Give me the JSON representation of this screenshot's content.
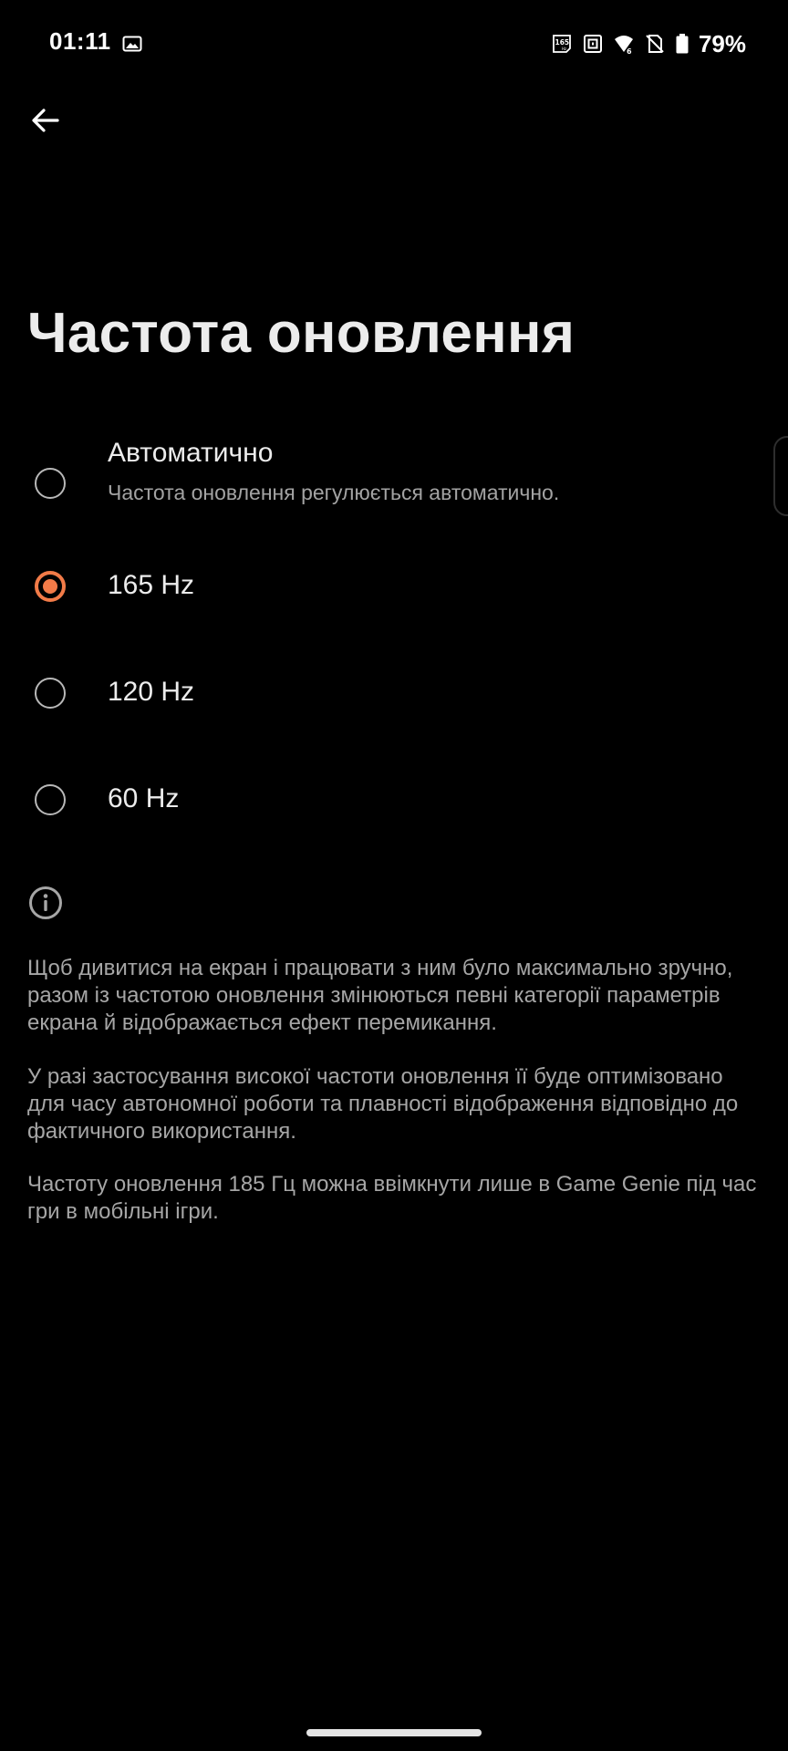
{
  "status_bar": {
    "time": "01:11",
    "battery": "79%",
    "icons": [
      "gallery-icon",
      "refresh-rate-165-icon",
      "nfc-icon",
      "wifi-icon",
      "no-sim-icon",
      "battery-icon"
    ],
    "refresh_badge": "165"
  },
  "page": {
    "title": "Частота оновлення",
    "back_icon": "arrow-left-icon"
  },
  "options": [
    {
      "label": "Автоматично",
      "description": "Частота оновлення регулюється автоматично.",
      "selected": false
    },
    {
      "label": "165 Hz",
      "selected": true
    },
    {
      "label": "120 Hz",
      "selected": false
    },
    {
      "label": "60 Hz",
      "selected": false
    }
  ],
  "info": {
    "icon": "info-icon",
    "paragraphs": [
      "Щоб дивитися на екран і працювати з ним було максимально зручно, разом із частотою оновлення змінюються певні категорії параметрів екрана й відображається ефект перемикання.",
      "У разі застосування високої частоти оновлення її буде оптимізовано для часу автономної роботи та плавності відображення відповідно до фактичного використання.",
      "Частоту оновлення 185 Гц можна ввімкнути лише в Game Genie під час гри в мобільні ігри."
    ]
  },
  "colors": {
    "background": "#000000",
    "accent": "#f27b48",
    "text_primary": "#ececec",
    "text_secondary": "#a6a6a6"
  }
}
